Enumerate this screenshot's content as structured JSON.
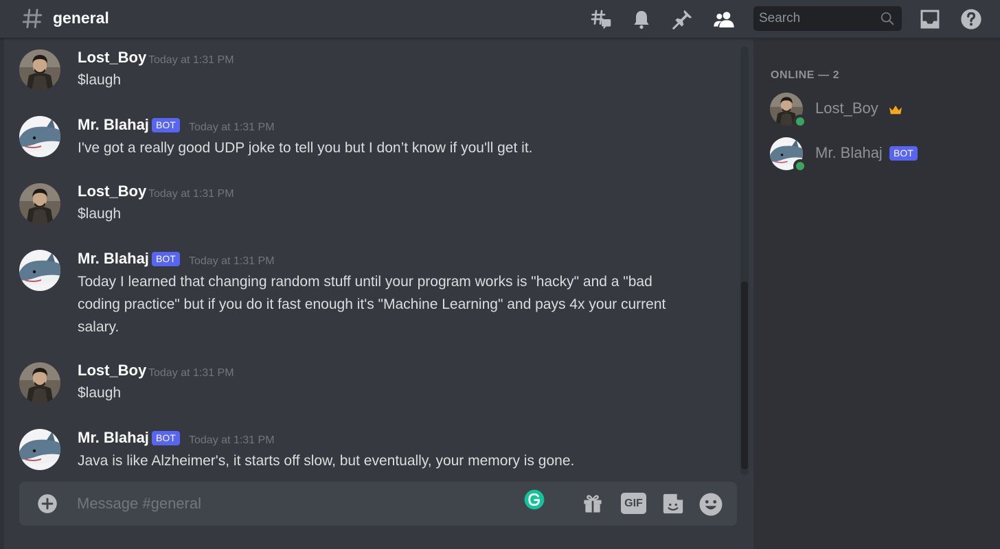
{
  "channel": {
    "name": "general",
    "hash_icon": "hash-icon"
  },
  "header_icons": [
    "threads-icon",
    "bell-icon",
    "pin-icon",
    "members-icon",
    "inbox-icon",
    "help-icon"
  ],
  "search": {
    "placeholder": "Search",
    "icon": "search-icon"
  },
  "messages": [
    {
      "author": "Lost_Boy",
      "bot_tag": "",
      "timestamp": "Today at 1:31 PM",
      "text": "$laugh"
    },
    {
      "author": "Mr. Blahaj",
      "bot_tag": "BOT",
      "timestamp": "Today at 1:31 PM",
      "text": "I've got a really good UDP joke to tell you but I don’t know if you'll get it."
    },
    {
      "author": "Lost_Boy",
      "bot_tag": "",
      "timestamp": "Today at 1:31 PM",
      "text": "$laugh"
    },
    {
      "author": "Mr. Blahaj",
      "bot_tag": "BOT",
      "timestamp": "Today at 1:31 PM",
      "text": "Today I learned that changing random stuff until your program works is \"hacky\" and a \"bad coding practice\" but if you do it fast enough it's \"Machine Learning\" and pays 4x your current salary."
    },
    {
      "author": "Lost_Boy",
      "bot_tag": "",
      "timestamp": "Today at 1:31 PM",
      "text": "$laugh"
    },
    {
      "author": "Mr. Blahaj",
      "bot_tag": "BOT",
      "timestamp": "Today at 1:31 PM",
      "text": "Java is like Alzheimer's, it starts off slow, but eventually, your memory is gone."
    }
  ],
  "composer": {
    "placeholder": "Message #general",
    "gif_label": "GIF",
    "icons": [
      "add-attachment-icon",
      "grammarly-icon",
      "gift-icon",
      "gif-icon",
      "sticker-icon",
      "emoji-icon"
    ]
  },
  "members": {
    "online_header": "ONLINE — 2",
    "list": [
      {
        "name": "Lost_Boy",
        "badge": "crown-icon",
        "status": "online"
      },
      {
        "name": "Mr. Blahaj",
        "bot_tag": "BOT",
        "status": "online"
      }
    ]
  },
  "colors": {
    "background": "#36393f",
    "sidebar": "#2f3136",
    "bot_tag": "#5865f2",
    "online": "#3ba55d",
    "crown": "#faa61a",
    "grammarly": "#15c39a"
  }
}
